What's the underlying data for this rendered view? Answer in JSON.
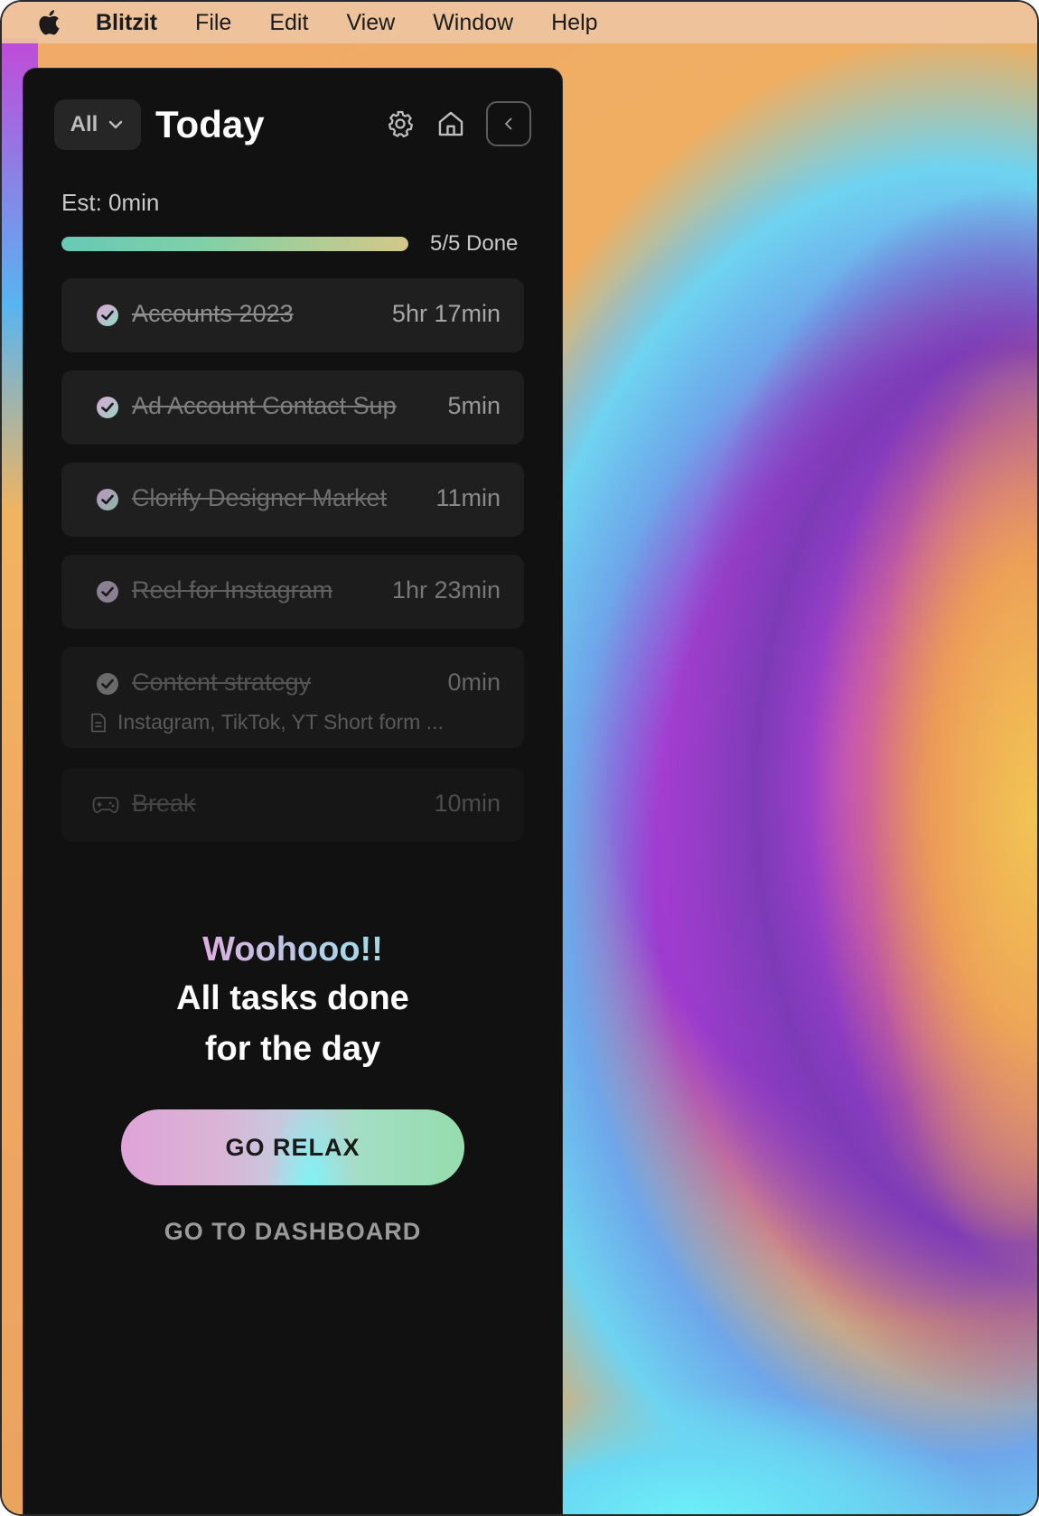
{
  "menubar": {
    "app_name": "Blitzit",
    "items": [
      "File",
      "Edit",
      "View",
      "Window",
      "Help"
    ]
  },
  "header": {
    "filter_value": "All",
    "title": "Today"
  },
  "summary": {
    "estimate": "Est: 0min",
    "done_label": "5/5 Done",
    "progress": 1.0
  },
  "tasks": [
    {
      "name": "Accounts 2023",
      "duration": "5hr 17min",
      "done": true
    },
    {
      "name": "Ad Account Contact Sup",
      "duration": "5min",
      "done": true
    },
    {
      "name": "Clorify Designer Market",
      "duration": "11min",
      "done": true
    },
    {
      "name": "Reel for Instagram",
      "duration": "1hr 23min",
      "done": true
    },
    {
      "name": "Content strategy",
      "duration": "0min",
      "done": true,
      "note": "Instagram, TikTok, YT Short form ..."
    },
    {
      "name": "Break",
      "duration": "10min",
      "done": true
    }
  ],
  "celebration": {
    "headline": "Woohooo!!",
    "line1": "All tasks done",
    "line2": "for the day"
  },
  "actions": {
    "primary": "GO RELAX",
    "secondary": "GO TO DASHBOARD"
  },
  "colors": {
    "panel_bg": "#111111",
    "card_bg": "#1f1f1f",
    "progress_start": "#67c9b6",
    "progress_end": "#d4c78a"
  }
}
